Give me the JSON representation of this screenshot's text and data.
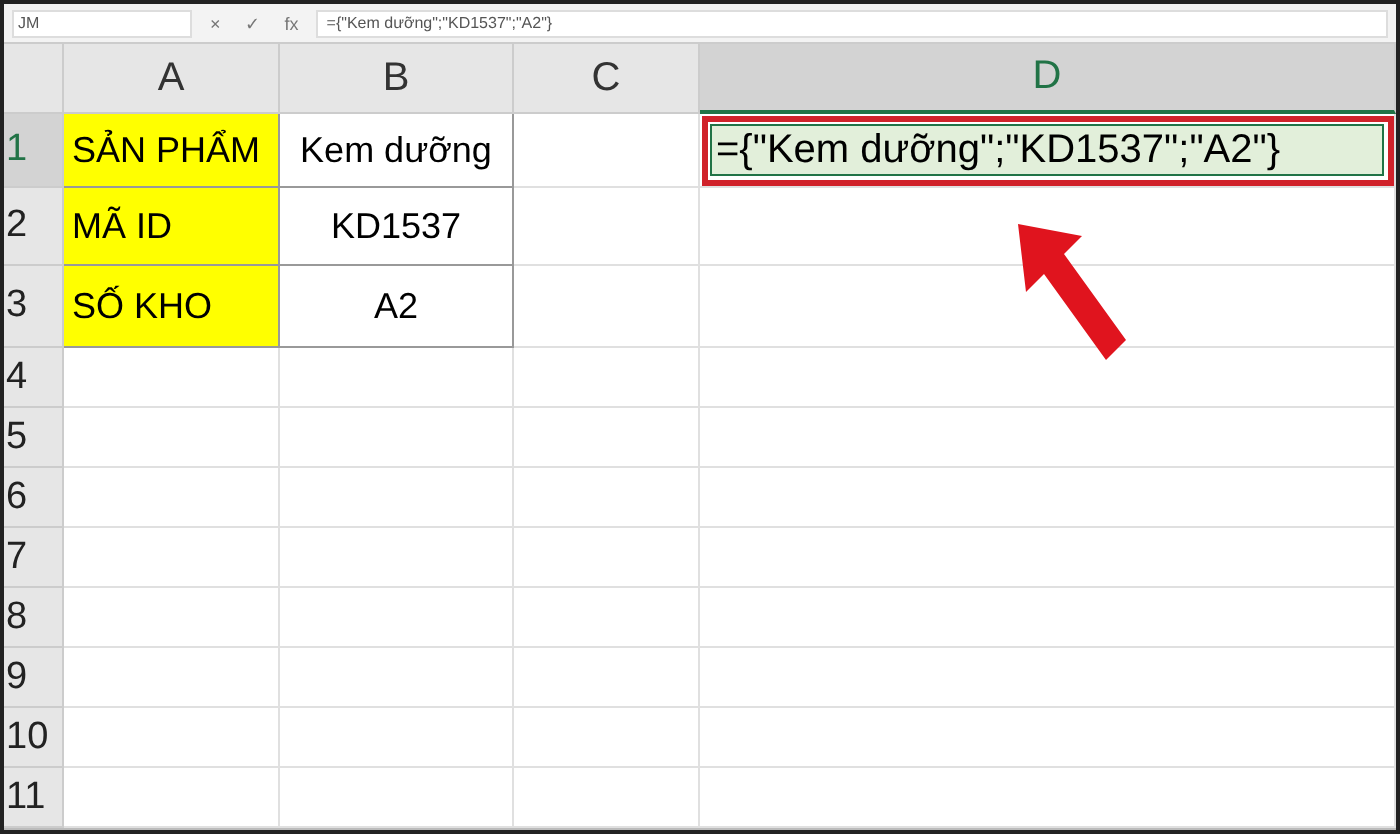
{
  "formula_bar": {
    "name_box": "JM",
    "cancel": "×",
    "enter": "✓",
    "function": "fx",
    "formula": "={\"Kem dưỡng\";\"KD1537\";\"A2\"}"
  },
  "columns": [
    {
      "label": "A",
      "selected": false
    },
    {
      "label": "B",
      "selected": false
    },
    {
      "label": "C",
      "selected": false
    },
    {
      "label": "D",
      "selected": true
    }
  ],
  "rows": [
    {
      "label": "1",
      "selected": true,
      "cells": [
        {
          "kind": "highlight",
          "text": "SẢN PHẨM"
        },
        {
          "kind": "boxed",
          "text": "Kem dưỡng"
        },
        {
          "kind": "empty"
        },
        {
          "kind": "editing",
          "text": "={\"Kem dưỡng\";\"KD1537\";\"A2\"}"
        }
      ]
    },
    {
      "label": "2",
      "selected": false,
      "cells": [
        {
          "kind": "highlight",
          "text": "MÃ ID"
        },
        {
          "kind": "boxed",
          "text": "KD1537"
        }
      ]
    },
    {
      "label": "3",
      "selected": false,
      "cells": [
        {
          "kind": "highlight",
          "text": "SỐ KHO"
        },
        {
          "kind": "boxed",
          "text": "A2"
        }
      ]
    },
    {
      "label": "4",
      "selected": false
    },
    {
      "label": "5",
      "selected": false
    },
    {
      "label": "6",
      "selected": false
    },
    {
      "label": "7",
      "selected": false
    },
    {
      "label": "8",
      "selected": false
    },
    {
      "label": "9",
      "selected": false
    },
    {
      "label": "10",
      "selected": false
    },
    {
      "label": "11",
      "selected": false
    }
  ]
}
